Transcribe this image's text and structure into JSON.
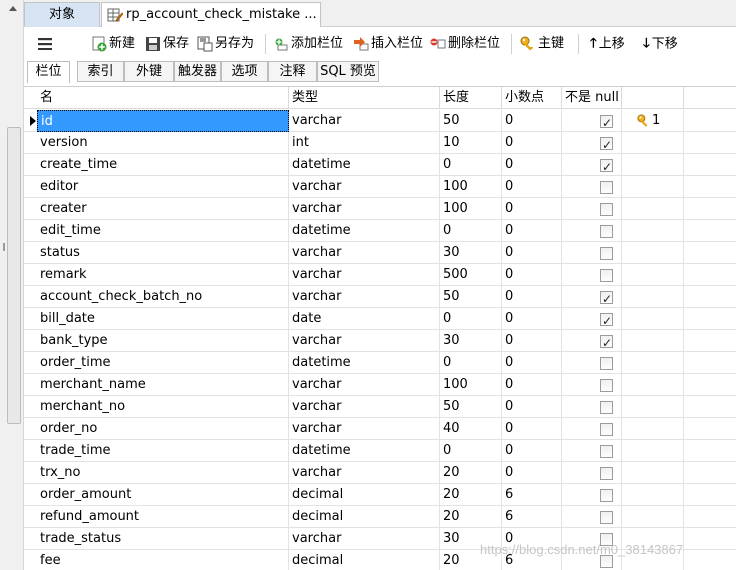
{
  "window": {
    "tabs": [
      {
        "label": "对象"
      },
      {
        "label": "rp_account_check_mistake ..."
      }
    ]
  },
  "toolbar": {
    "menu_icon": "hamburger-icon",
    "new_label": "新建",
    "save_label": "保存",
    "save_as_label": "另存为",
    "add_column_label": "添加栏位",
    "insert_column_label": "插入栏位",
    "delete_column_label": "删除栏位",
    "primary_key_label": "主键",
    "move_up_label": "上移",
    "move_down_label": "下移"
  },
  "sub_tabs": [
    "栏位",
    "索引",
    "外键",
    "触发器",
    "选项",
    "注释",
    "SQL 预览"
  ],
  "columns_header": {
    "name": "名",
    "type": "类型",
    "length": "长度",
    "decimals": "小数点",
    "not_null": "不是 null",
    "key": ""
  },
  "rows": [
    {
      "name": "id",
      "type": "varchar",
      "length": "50",
      "decimals": "0",
      "not_null": true,
      "key": "1"
    },
    {
      "name": "version",
      "type": "int",
      "length": "10",
      "decimals": "0",
      "not_null": true,
      "key": ""
    },
    {
      "name": "create_time",
      "type": "datetime",
      "length": "0",
      "decimals": "0",
      "not_null": true,
      "key": ""
    },
    {
      "name": "editor",
      "type": "varchar",
      "length": "100",
      "decimals": "0",
      "not_null": false,
      "key": ""
    },
    {
      "name": "creater",
      "type": "varchar",
      "length": "100",
      "decimals": "0",
      "not_null": false,
      "key": ""
    },
    {
      "name": "edit_time",
      "type": "datetime",
      "length": "0",
      "decimals": "0",
      "not_null": false,
      "key": ""
    },
    {
      "name": "status",
      "type": "varchar",
      "length": "30",
      "decimals": "0",
      "not_null": false,
      "key": ""
    },
    {
      "name": "remark",
      "type": "varchar",
      "length": "500",
      "decimals": "0",
      "not_null": false,
      "key": ""
    },
    {
      "name": "account_check_batch_no",
      "type": "varchar",
      "length": "50",
      "decimals": "0",
      "not_null": true,
      "key": ""
    },
    {
      "name": "bill_date",
      "type": "date",
      "length": "0",
      "decimals": "0",
      "not_null": true,
      "key": ""
    },
    {
      "name": "bank_type",
      "type": "varchar",
      "length": "30",
      "decimals": "0",
      "not_null": true,
      "key": ""
    },
    {
      "name": "order_time",
      "type": "datetime",
      "length": "0",
      "decimals": "0",
      "not_null": false,
      "key": ""
    },
    {
      "name": "merchant_name",
      "type": "varchar",
      "length": "100",
      "decimals": "0",
      "not_null": false,
      "key": ""
    },
    {
      "name": "merchant_no",
      "type": "varchar",
      "length": "50",
      "decimals": "0",
      "not_null": false,
      "key": ""
    },
    {
      "name": "order_no",
      "type": "varchar",
      "length": "40",
      "decimals": "0",
      "not_null": false,
      "key": ""
    },
    {
      "name": "trade_time",
      "type": "datetime",
      "length": "0",
      "decimals": "0",
      "not_null": false,
      "key": ""
    },
    {
      "name": "trx_no",
      "type": "varchar",
      "length": "20",
      "decimals": "0",
      "not_null": false,
      "key": ""
    },
    {
      "name": "order_amount",
      "type": "decimal",
      "length": "20",
      "decimals": "6",
      "not_null": false,
      "key": ""
    },
    {
      "name": "refund_amount",
      "type": "decimal",
      "length": "20",
      "decimals": "6",
      "not_null": false,
      "key": ""
    },
    {
      "name": "trade_status",
      "type": "varchar",
      "length": "30",
      "decimals": "0",
      "not_null": false,
      "key": ""
    },
    {
      "name": "fee",
      "type": "decimal",
      "length": "20",
      "decimals": "6",
      "not_null": false,
      "key": ""
    }
  ],
  "watermark": "https://blog.csdn.net/m0_38143867"
}
